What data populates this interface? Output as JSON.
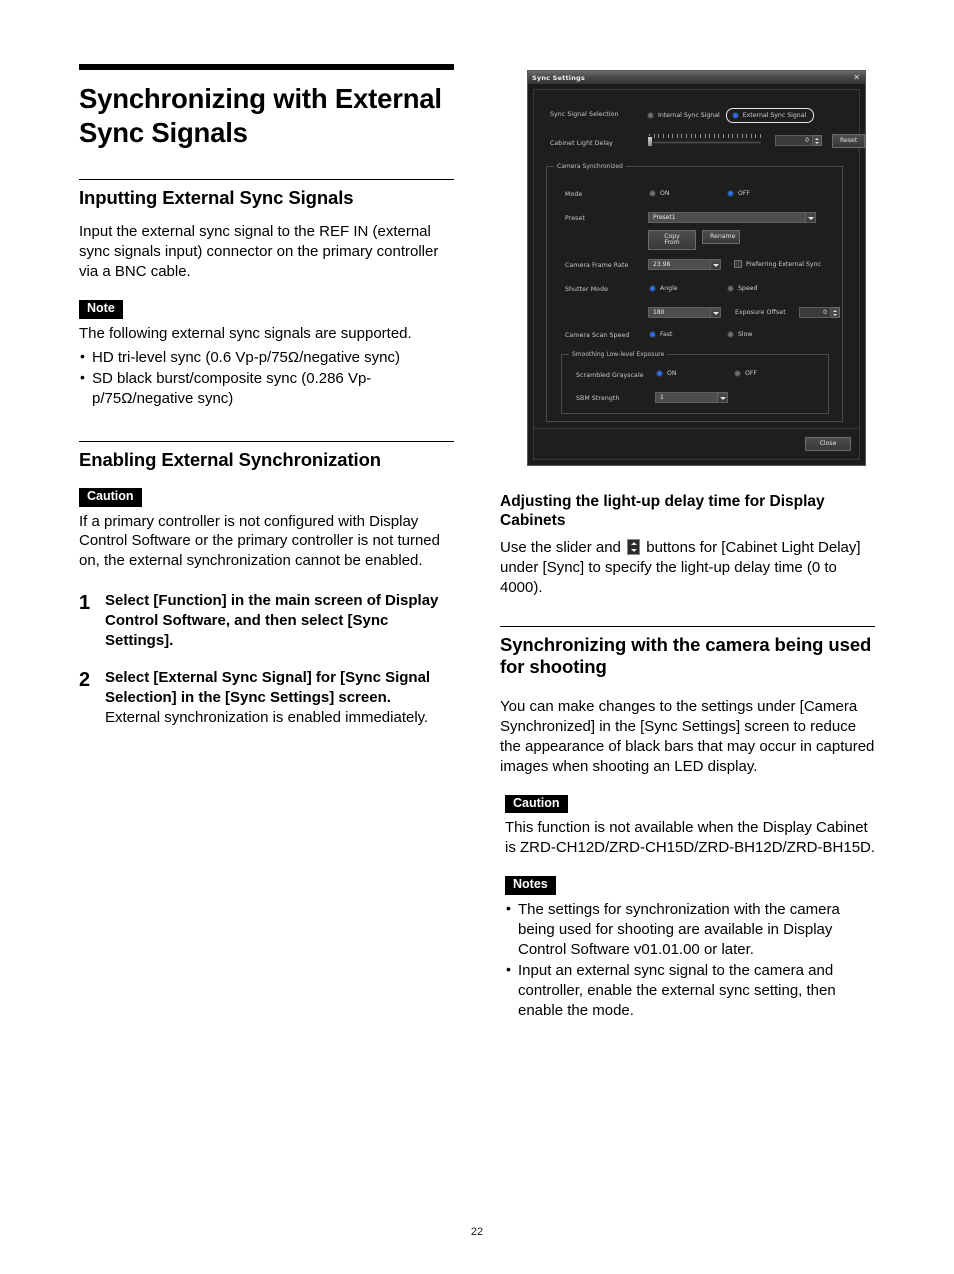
{
  "page": {
    "number": "22"
  },
  "left_column": {
    "title": "Synchronizing with External Sync Signals",
    "section1": {
      "heading": "Inputting External Sync Signals",
      "paragraph": "Input the external sync signal to the REF IN (external sync signals input) connector on the primary controller via a BNC cable.",
      "note_badge": "Note",
      "note_intro": "The following external sync signals are supported.",
      "note_bullets": [
        "HD tri-level sync (0.6 Vp-p/75Ω/negative sync)",
        "SD black burst/composite sync (0.286 Vp-p/75Ω/negative sync)"
      ]
    },
    "section2": {
      "heading": "Enabling External Synchronization",
      "caution_badge": "Caution",
      "caution_text": "If a primary controller is not configured with Display Control Software or the primary controller is not turned on, the external synchronization cannot be enabled.",
      "steps": [
        {
          "number": "1",
          "lead": "Select [Function] in the main screen of Display Control Software, and then select [Sync Settings].",
          "follow": ""
        },
        {
          "number": "2",
          "lead": "Select [External Sync Signal] for [Sync Signal Selection] in the [Sync Settings] screen.",
          "follow": "External synchronization is enabled immediately."
        }
      ]
    }
  },
  "right_column": {
    "section3": {
      "heading": "Adjusting the light-up delay time for Display Cabinets",
      "text_before_icon": "Use the slider and",
      "inline_icon_name": "spinner-up-down-icon",
      "text_after_icon": "buttons for [Cabinet Light Delay] under [Sync] to specify the light-up delay time (0 to 4000)."
    },
    "section4": {
      "heading": "Synchronizing with the camera being used for shooting",
      "paragraph": "You can make changes to the settings under [Camera Synchronized] in the [Sync Settings] screen to reduce the appearance of black bars that may occur in captured images when shooting an LED display.",
      "caution_badge": "Caution",
      "caution_text": "This function is not available when the Display Cabinet is ZRD-CH12D/ZRD-CH15D/ZRD-BH12D/ZRD-BH15D.",
      "notes_badge": "Notes",
      "notes_bullets": [
        "The settings for synchronization with the camera being used for shooting are available in Display Control Software v01.01.00 or later.",
        "Input an external sync signal to the camera and controller, enable the external sync setting, then enable the mode."
      ]
    }
  },
  "dialog": {
    "title": "Sync Settings",
    "close_icon": "close-icon",
    "sync_signal_selection": {
      "label": "Sync Signal Selection",
      "options": [
        {
          "label": "Internal Sync Signal",
          "selected": false
        },
        {
          "label": "External Sync Signal",
          "selected": true
        }
      ]
    },
    "cabinet_light_delay": {
      "label": "Cabinet Light Delay",
      "value": "0",
      "reset_label": "Reset"
    },
    "camera_synchronized": {
      "group_title": "Camera Synchronized",
      "mode": {
        "label": "Mode",
        "options": [
          {
            "label": "ON",
            "selected": false
          },
          {
            "label": "OFF",
            "selected": true
          }
        ]
      },
      "preset": {
        "label": "Preset",
        "value": "Preset1",
        "copy_from_label": "Copy From",
        "rename_label": "Rename"
      },
      "camera_frame_rate": {
        "label": "Camera Frame Rate",
        "value": "23.98",
        "preferring_external_sync_label": "Preferring External Sync",
        "preferring_external_sync_checked": false
      },
      "shutter_mode": {
        "label": "Shutter Mode",
        "options": [
          {
            "label": "Angle",
            "selected": true
          },
          {
            "label": "Speed",
            "selected": false
          }
        ],
        "value": "180",
        "exposure_offset_label": "Exposure Offset",
        "exposure_offset_value": "0"
      },
      "camera_scan_speed": {
        "label": "Camera Scan Speed",
        "options": [
          {
            "label": "Fast",
            "selected": true
          },
          {
            "label": "Slow",
            "selected": false
          }
        ]
      },
      "smoothing": {
        "group_title": "Smoothing Low-level Exposure",
        "scrambled_grayscale": {
          "label": "Scrambled Grayscale",
          "options": [
            {
              "label": "ON",
              "selected": true
            },
            {
              "label": "OFF",
              "selected": false
            }
          ]
        },
        "sbm_strength": {
          "label": "SBM Strength",
          "value": "1"
        }
      }
    },
    "close_button_label": "Close",
    "accent_color": "#2a6fe8"
  }
}
